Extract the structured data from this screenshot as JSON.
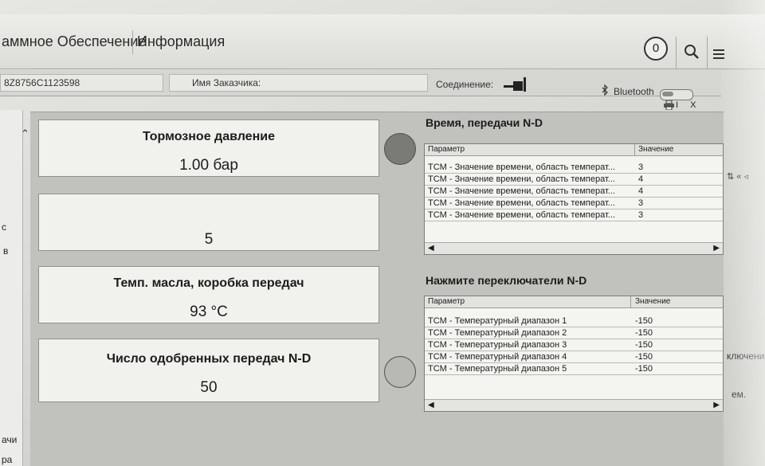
{
  "menu": {
    "items": [
      "аммное Обеспечение",
      "Информация"
    ],
    "notification_count": "0"
  },
  "info": {
    "vin_fragment": "8Z8756C1123598",
    "customer_label": "Имя Заказчика:",
    "connection_label": "Соединение:",
    "bluetooth_label": "Bluetooth"
  },
  "window_controls": "I X",
  "sidebar": {
    "frag_1": "с",
    "frag_2": "в",
    "frag_3": "ачи",
    "frag_4": "ра"
  },
  "cards": [
    {
      "title": "Тормозное давление",
      "value": "1.00 бар"
    },
    {
      "title": "",
      "value": "5"
    },
    {
      "title": "Темп. масла, коробка передач",
      "value": "93 °C"
    },
    {
      "title": "Число одобренных передач N-D",
      "value": "50"
    }
  ],
  "grid1": {
    "title": "Время, передачи N-D",
    "col_param": "Параметр",
    "col_value": "Значение",
    "rows": [
      {
        "param": "TCM - Значение времени, область температ...",
        "value": "3"
      },
      {
        "param": "TCM - Значение времени, область температ...",
        "value": "4"
      },
      {
        "param": "TCM - Значение времени, область температ...",
        "value": "4"
      },
      {
        "param": "TCM - Значение времени, область температ...",
        "value": "3"
      },
      {
        "param": "TCM - Значение времени, область температ...",
        "value": "3"
      }
    ]
  },
  "grid2": {
    "title": "Нажмите переключатели N-D",
    "col_param": "Параметр",
    "col_value": "Значение",
    "rows": [
      {
        "param": "TCM - Температурный диапазон 1",
        "value": "-150"
      },
      {
        "param": "TCM - Температурный диапазон 2",
        "value": "-150"
      },
      {
        "param": "TCM - Температурный диапазон 3",
        "value": "-150"
      },
      {
        "param": "TCM - Температурный диапазон 4",
        "value": "-150"
      },
      {
        "param": "TCM - Температурный диапазон 5",
        "value": "-150"
      }
    ]
  },
  "right_fragments": {
    "frag_1": "ключени",
    "frag_2": "ем."
  },
  "colors": {
    "led_dark": "#7a7a76",
    "led_light": "#b8b8b4"
  }
}
